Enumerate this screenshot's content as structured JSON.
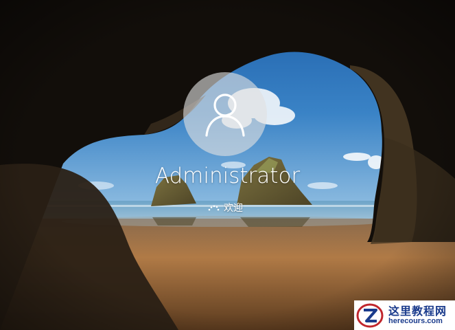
{
  "lock_screen": {
    "user_name": "Administrator",
    "status_text": "欢迎",
    "avatar_icon": "user-icon",
    "spinner_icon": "loading-dots-icon"
  },
  "watermark": {
    "title": "这里教程网",
    "url": "herecours.com",
    "logo_icon": "z-logo-icon"
  },
  "colors": {
    "sky": "#2f6fb4",
    "sand": "#b07a46",
    "cave": "#0d0b08",
    "watermark_text": "#1a3b8c"
  }
}
